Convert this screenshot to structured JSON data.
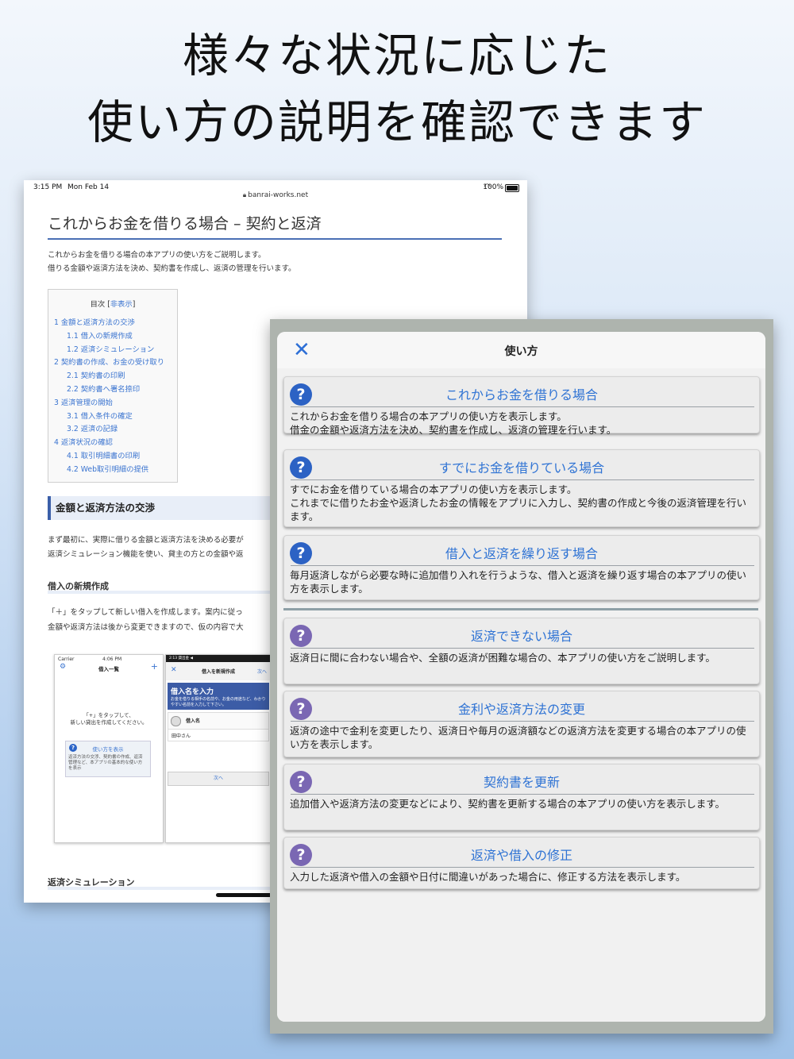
{
  "headline": {
    "line1": "様々な状況に応じた",
    "line2": "使い方の説明を確認できます"
  },
  "web": {
    "status": {
      "time": "3:15 PM",
      "date": "Mon Feb 14",
      "battery": "100%"
    },
    "url": "banrai-works.net",
    "title": "これからお金を借りる場合 – 契約と返済",
    "intro": [
      "これからお金を借りる場合の本アプリの使い方をご説明します。",
      "借りる金額や返済方法を決め、契約書を作成し、返済の管理を行います。"
    ],
    "toc": {
      "title": "目次",
      "hide_label": "非表示",
      "items": [
        {
          "label": "1 金額と返済方法の交渉",
          "sub": false
        },
        {
          "label": "1.1 借入の新規作成",
          "sub": true
        },
        {
          "label": "1.2 返済シミュレーション",
          "sub": true
        },
        {
          "label": "2 契約書の作成、お金の受け取り",
          "sub": false
        },
        {
          "label": "2.1 契約書の印刷",
          "sub": true
        },
        {
          "label": "2.2 契約書へ署名捺印",
          "sub": true
        },
        {
          "label": "3 返済管理の開始",
          "sub": false
        },
        {
          "label": "3.1 借入条件の確定",
          "sub": true
        },
        {
          "label": "3.2 返済の記録",
          "sub": true
        },
        {
          "label": "4 返済状況の確認",
          "sub": false
        },
        {
          "label": "4.1 取引明細書の印刷",
          "sub": true
        },
        {
          "label": "4.2 Web取引明細の提供",
          "sub": true
        }
      ]
    },
    "section1": "金額と返済方法の交渉",
    "para1": [
      "まず最初に、実際に借りる金額と返済方法を決める必要が",
      "返済シミュレーション機能を使い、貸主の方との金額や返"
    ],
    "subhead1": "借入の新規作成",
    "para2": [
      "「＋」をタップして新しい借入を作成します。案内に従っ",
      "金額や返済方法は後から変更できますので、仮の内容で大"
    ],
    "phone1": {
      "carrier": "Carrier",
      "time": "4:06 PM",
      "title": "借入一覧",
      "message": [
        "「+」をタップして、",
        "新しい貸出を作成してください。"
      ],
      "card_title": "使い方を表示",
      "card_desc": "返済方法の交渉、契約書の作成、返済管理など、本アプリの基本的な使い方を表示"
    },
    "phone2": {
      "status": "2:13 貸出金 ◀",
      "title": "借入を新規作成",
      "next_top": "次へ",
      "banner_title": "借入名を入力",
      "banner_desc": "お金を借りる相手の名前や、お金の用途など、わかりやすい名前を入力して下さい。",
      "field_label": "借入名",
      "field_value": "田中さん",
      "next_button": "次へ"
    },
    "subhead2": "返済シミュレーション"
  },
  "panel": {
    "title": "使い方",
    "close_icon": "close-x-icon",
    "cards": [
      {
        "title": "これからお金を借りる場合",
        "icon_color": "blue",
        "desc": "これからお金を借りる場合の本アプリの使い方を表示します。\n借金の金額や返済方法を決め、契約書を作成し、返済の管理を行います。"
      },
      {
        "title": "すでにお金を借りている場合",
        "icon_color": "blue",
        "desc": "すでにお金を借りている場合の本アプリの使い方を表示します。\nこれまでに借りたお金や返済したお金の情報をアプリに入力し、契約書の作成と今後の返済管理を行います。"
      },
      {
        "title": "借入と返済を繰り返す場合",
        "icon_color": "blue",
        "desc": "毎月返済しながら必要な時に追加借り入れを行うような、借入と返済を繰り返す場合の本アプリの使い方を表示します。"
      },
      {
        "title": "返済できない場合",
        "icon_color": "purple",
        "desc": "返済日に間に合わない場合や、全額の返済が困難な場合の、本アプリの使い方をご説明します。"
      },
      {
        "title": "金利や返済方法の変更",
        "icon_color": "purple",
        "desc": "返済の途中で金利を変更したり、返済日や毎月の返済額などの返済方法を変更する場合の本アプリの使い方を表示します。"
      },
      {
        "title": "契約書を更新",
        "icon_color": "purple",
        "desc": "追加借入や返済方法の変更などにより、契約書を更新する場合の本アプリの使い方を表示します。"
      },
      {
        "title": "返済や借入の修正",
        "icon_color": "purple",
        "desc": "入力した返済や借入の金額や日付に間違いがあった場合に、修正する方法を表示します。"
      }
    ],
    "colors": {
      "accent": "#2f73d4",
      "blue_icon": "#2c62c4",
      "purple_icon": "#7a67b3"
    }
  }
}
